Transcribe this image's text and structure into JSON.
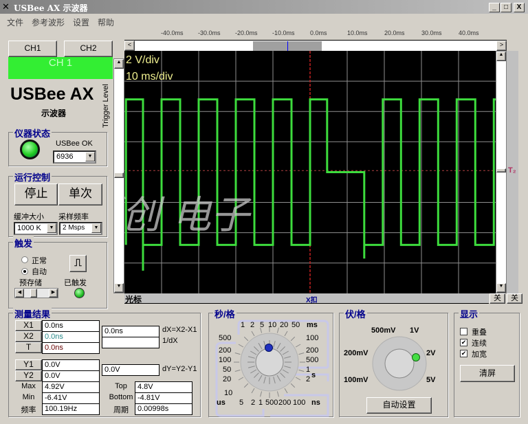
{
  "window": {
    "title": "USBee AX 示波器",
    "minimize": "_",
    "maximize": "□",
    "close": "X"
  },
  "menu": [
    "文件",
    "参考波形",
    "设置",
    "帮助"
  ],
  "time_axis": [
    "-40.0ms",
    "-30.0ms",
    "-20.0ms",
    "-10.0ms",
    "0.0ms",
    "10.0ms",
    "20.0ms",
    "30.0ms",
    "40.0ms"
  ],
  "channels": {
    "ch1": "CH1",
    "ch2": "CH2",
    "active": "CH 1",
    "active_color": "#33ee33"
  },
  "brand": {
    "name": "USBee AX",
    "subtitle": "示波器",
    "trigger_level": "Trigger Level"
  },
  "status": {
    "label": "仪器状态",
    "text": "USBee OK",
    "device": "6936"
  },
  "run": {
    "label": "运行控制",
    "stop": "停止",
    "single": "单次",
    "buffer_label": "缓冲大小",
    "rate_label": "采样频率",
    "buffer": "1000 K",
    "rate": "2 Msps"
  },
  "trigger": {
    "label": "触发",
    "normal": "正常",
    "auto": "自动",
    "selected": "auto",
    "prestore": "预存储",
    "triggered": "已触发"
  },
  "scope": {
    "volts_div": "2 V/div",
    "time_div": "10 ms/div",
    "cursor_label": "光标",
    "x_marker": "X扣",
    "t_marker": "T₂",
    "off1": "关",
    "off2": "关",
    "watermark": "跃创 电子",
    "trace_color": "#3ddc3d",
    "trace": [
      [
        -49.6,
        -4.8
      ],
      [
        -49.6,
        4.8
      ],
      [
        -45,
        4.8
      ],
      [
        -45,
        -6.5
      ],
      [
        -45,
        -4.8
      ],
      [
        -40,
        -4.8
      ],
      [
        -40,
        4.8
      ],
      [
        -35,
        4.8
      ],
      [
        -35,
        -4.8
      ],
      [
        -30,
        -4.8
      ],
      [
        -30,
        4.8
      ],
      [
        -25,
        4.8
      ],
      [
        -25,
        -4.8
      ],
      [
        -20,
        -4.8
      ],
      [
        -20,
        4.8
      ],
      [
        -15,
        4.8
      ],
      [
        -15,
        -4.8
      ],
      [
        -10,
        -4.8
      ],
      [
        -10,
        4.8
      ],
      [
        -5,
        4.8
      ],
      [
        -5,
        -4.8
      ],
      [
        0,
        -4.8
      ],
      [
        0,
        4.8
      ],
      [
        4.6,
        4.8
      ],
      [
        4.6,
        0
      ],
      [
        14.6,
        0
      ],
      [
        14.6,
        -5.7
      ],
      [
        14.6,
        -4.8
      ],
      [
        19.6,
        -4.8
      ],
      [
        19.6,
        4.8
      ],
      [
        24.5,
        4.8
      ],
      [
        24.5,
        -4.8
      ],
      [
        29.5,
        -4.8
      ],
      [
        29.5,
        4.8
      ],
      [
        34.5,
        4.8
      ],
      [
        34.5,
        -4.8
      ],
      [
        39.5,
        -4.8
      ],
      [
        39.5,
        4.8
      ],
      [
        44.5,
        4.8
      ],
      [
        44.5,
        -4.8
      ],
      [
        49.5,
        -4.8
      ],
      [
        49.5,
        4.8
      ],
      [
        50,
        4.8
      ]
    ],
    "time_range_ms": [
      -50,
      50
    ],
    "volt_range": [
      -8,
      8
    ],
    "trigger_level_v": 0.1
  },
  "measure": {
    "label": "测量结果",
    "x1": "X1",
    "x1v": "0.0ns",
    "x2": "X2",
    "x2v": "0.0ns",
    "t": "T",
    "tv": "0.0ns",
    "dx": "0.0ns",
    "inv_dx": "",
    "dx_label": "dX=X2-X1",
    "inv_dx_label": "1/dX",
    "y1": "Y1",
    "y1v": "0.0V",
    "y2": "Y2",
    "y2v": "0.0V",
    "dy": "0.0V",
    "dy_label": "dY=Y2-Y1",
    "max": "Max",
    "maxv": "4.92V",
    "min": "Min",
    "minv": "-6.41V",
    "freq": "频率",
    "freqv": "100.19Hz",
    "top": "Top",
    "topv": "4.8V",
    "bottom": "Bottom",
    "bottomv": "-4.81V",
    "period": "周期",
    "periodv": "0.00998s"
  },
  "timebase": {
    "label": "秒/格",
    "ms": [
      "1",
      "2",
      "5",
      "10",
      "20",
      "50"
    ],
    "ms_unit": "ms",
    "right": [
      "100",
      "200",
      "500",
      "1",
      "2"
    ],
    "s_unit": "s",
    "left": [
      "500",
      "200",
      "100",
      "50",
      "20",
      "10"
    ],
    "us_unit": "us",
    "us": [
      "5",
      "2",
      "1"
    ],
    "ns": [
      "500",
      "200",
      "100"
    ],
    "ns_unit": "ns",
    "selected": "10 ms"
  },
  "voltbase": {
    "label": "伏/格",
    "opts": [
      "500mV",
      "1V",
      "200mV",
      "2V",
      "100mV",
      "5V"
    ],
    "selected": "2V",
    "auto": "自动设置"
  },
  "display": {
    "label": "显示",
    "overlay": "重叠",
    "overlay_checked": false,
    "continuous": "连续",
    "continuous_checked": true,
    "wide": "加宽",
    "wide_checked": true,
    "clear": "清屏"
  }
}
